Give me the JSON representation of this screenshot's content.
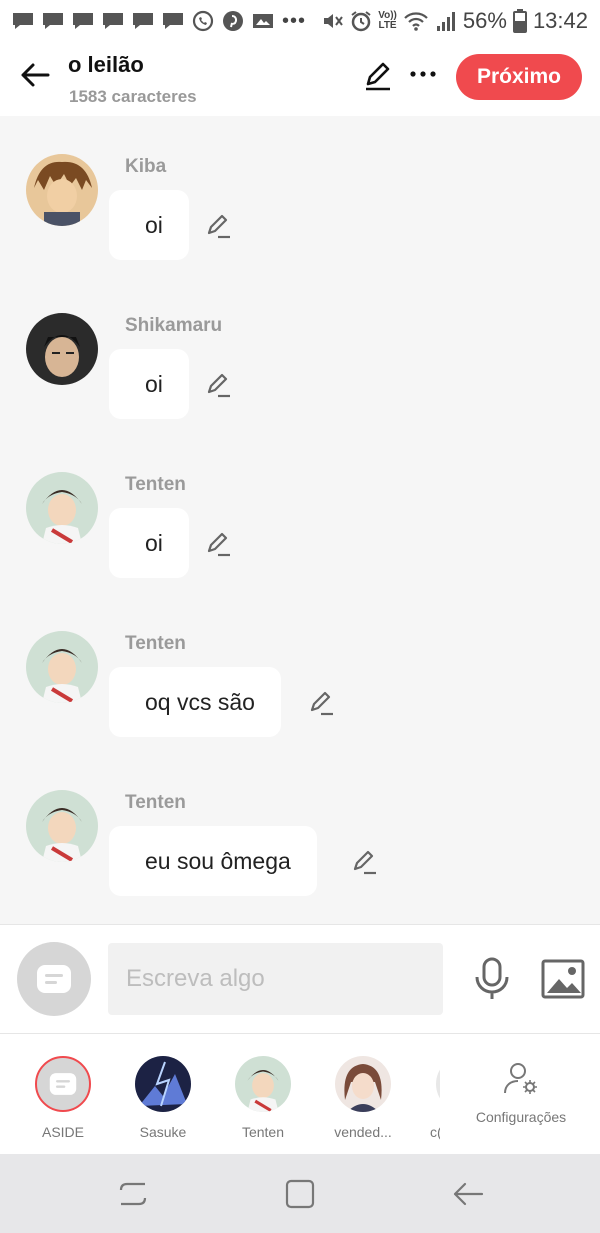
{
  "status_bar": {
    "battery": "56%",
    "time": "13:42",
    "lte_top": "Vo))",
    "lte_bottom": "LTE"
  },
  "header": {
    "title": "o leilão",
    "subtitle": "1583 caracteres",
    "next_label": "Próximo",
    "accent": "#f04a4e"
  },
  "messages": [
    {
      "sender": "Kiba",
      "text": "oi"
    },
    {
      "sender": "Shikamaru",
      "text": "oi"
    },
    {
      "sender": "Tenten",
      "text": "oi"
    },
    {
      "sender": "Tenten",
      "text": "oq vcs são"
    },
    {
      "sender": "Tenten",
      "text": "eu sou ômega"
    }
  ],
  "composer": {
    "placeholder": "Escreva algo"
  },
  "characters": [
    {
      "label": "ASIDE"
    },
    {
      "label": "Sasuke"
    },
    {
      "label": "Tenten"
    },
    {
      "label": "vended..."
    },
    {
      "label": "c("
    }
  ],
  "settings": {
    "label": "Configurações"
  }
}
